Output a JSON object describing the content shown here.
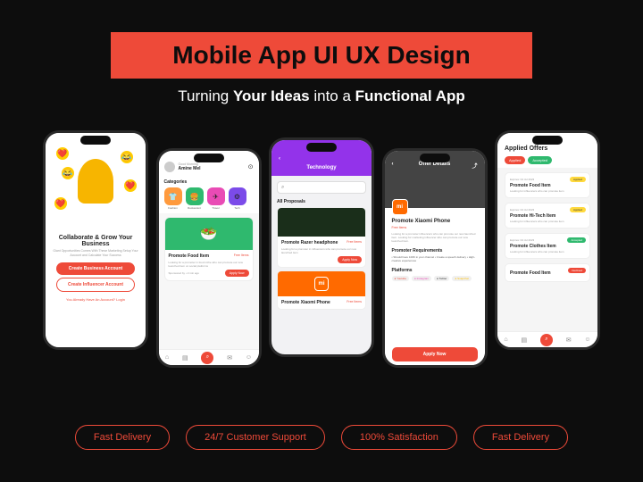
{
  "hero": {
    "title": "Mobile App UI UX Design"
  },
  "subtitle": {
    "pre": "Turning ",
    "b1": "Your Ideas",
    "mid": " into a ",
    "b2": "Functional App"
  },
  "phone1": {
    "heading": "Collaborate & Grow Your Business",
    "sub": "Giant Opportunities Comes With These Marketing Setup Your Account and Calculate Your Success",
    "btn1": "Create Business Account",
    "btn2": "Create Influencer Account",
    "footer": "You Already Have An Account? ",
    "login": "Login"
  },
  "phone2": {
    "greet": "Good Morning",
    "name": "Amine Mel",
    "categories_label": "Categories",
    "cats": [
      {
        "label": "Fashion",
        "emoji": "👕",
        "bg": "#ff9a3d"
      },
      {
        "label": "Restaurant",
        "emoji": "🍔",
        "bg": "#2fb96e"
      },
      {
        "label": "Travel",
        "emoji": "✈",
        "bg": "#e94bb5"
      },
      {
        "label": "Tech",
        "emoji": "⚙",
        "bg": "#7b4be9"
      }
    ],
    "card": {
      "title": "Promote Food Item",
      "tag": "Free Items",
      "desc": "Looking for a promoter in food niche who can promote our new launched item on social platforms",
      "meta": "Sponsored by • 2 min ago",
      "btn": "Apply Now"
    }
  },
  "phone3": {
    "tab": "Technology",
    "section": "All Proposals",
    "card1": {
      "title": "Promote Razer headphone",
      "tag": "Free Items",
      "desc": "Looking for a promoter in influencers who can promote our new launched item",
      "btn": "Apply Now"
    },
    "card2": {
      "title": "Promote Xiaomi Phone",
      "tag": "Free Items"
    }
  },
  "phone4": {
    "header": "Offer Details",
    "title": "Promote Xiaomi Phone",
    "tag": "Free Items",
    "desc": "Looking for a promoter influencers who can promote our new launched item. Looking for marketing influencer who can promote our new launched item.",
    "req_label": "Promoter Requirements",
    "reqs": "• Should have 100K in your channel\n• Create a speech delivery\n• High-creative experiences",
    "plat_label": "Platforms",
    "plats": [
      "Youtube",
      "Instagram",
      "Twitter",
      "Snapchat"
    ],
    "btn": "Apply Now"
  },
  "phone5": {
    "title": "Applied Offers",
    "chips": [
      "Applied",
      "Accepted"
    ],
    "cards": [
      {
        "date": "Expires: 04 Jul 2023",
        "title": "Promote Food Item",
        "desc": "Looking for influencers who can promote item",
        "badge": "Applied",
        "badge_cls": "bdg-y"
      },
      {
        "date": "Expires: 04 Jul 2023",
        "title": "Promote Hi-Tech Item",
        "desc": "Looking for influencers who can promote item",
        "badge": "Applied",
        "badge_cls": "bdg-y"
      },
      {
        "date": "Expires: 04 Jul 2023",
        "title": "Promote Clothes Item",
        "desc": "Looking for influencers who can promote item",
        "badge": "Accepted",
        "badge_cls": "bdg-g"
      },
      {
        "date": "",
        "title": "Promote Food Item",
        "desc": "",
        "badge": "Declined",
        "badge_cls": "bdg-r"
      }
    ]
  },
  "features": [
    "Fast Delivery",
    "24/7 Customer Support",
    "100% Satisfaction",
    "Fast Delivery"
  ]
}
